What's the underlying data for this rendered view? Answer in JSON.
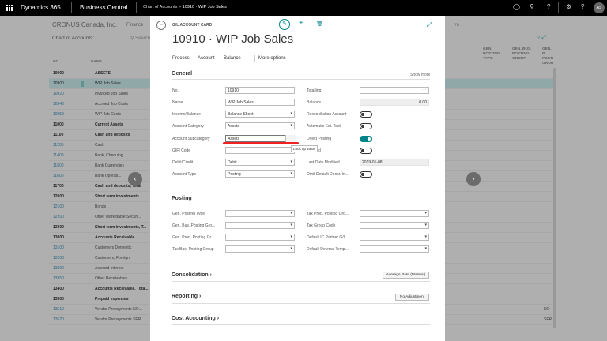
{
  "topbar": {
    "brand": "Dynamics 365",
    "app": "Business Central",
    "crumb_parent": "Chart of Accounts",
    "crumb_current": "10910 · WIP Job Sales",
    "user_initials": "AS"
  },
  "background": {
    "company": "CRONUS Canada, Inc.",
    "nav": "Finance",
    "nav_right": "rm",
    "list_title": "Chart of Accounts:",
    "search": "Search",
    "columns": {
      "no": "NO.",
      "name": "NAME",
      "gen_posting_type": "GEN. POSTING TYPE",
      "gen_bus_posting_group": "GEN. BUS. POSTING GROUP",
      "gen_prod_posting_group": "GEN. P POSTING GROU"
    },
    "rows": [
      {
        "no": "10000",
        "name": "ASSETS",
        "style": "b",
        "right": ""
      },
      {
        "no": "10900",
        "name": "WIP Job Sales",
        "style": "sel",
        "right": ""
      },
      {
        "no": "10920",
        "name": "Invoiced Job Sales",
        "style": "n",
        "right": ""
      },
      {
        "no": "10940",
        "name": "Accrued Job Costs",
        "style": "n",
        "right": ""
      },
      {
        "no": "10950",
        "name": "WIP Job Costs",
        "style": "n",
        "right": ""
      },
      {
        "no": "11000",
        "name": "Current Assets",
        "style": "b",
        "right": ""
      },
      {
        "no": "11100",
        "name": "Cash and deposits",
        "style": "b",
        "right": ""
      },
      {
        "no": "11200",
        "name": "Cash",
        "style": "n",
        "right": ""
      },
      {
        "no": "11400",
        "name": "Bank, Chequing",
        "style": "n",
        "right": ""
      },
      {
        "no": "11500",
        "name": "Bank Currencies",
        "style": "n",
        "right": ""
      },
      {
        "no": "11600",
        "name": "Bank Operati...",
        "style": "n",
        "right": ""
      },
      {
        "no": "11700",
        "name": "Cash and deposits, Total",
        "style": "b",
        "right": ""
      },
      {
        "no": "12000",
        "name": "Short term investments",
        "style": "b",
        "right": ""
      },
      {
        "no": "12100",
        "name": "Bonds",
        "style": "n",
        "right": ""
      },
      {
        "no": "12200",
        "name": "Other Marketable Securi...",
        "style": "n",
        "right": ""
      },
      {
        "no": "12300",
        "name": "Short term investments, T...",
        "style": "b",
        "right": ""
      },
      {
        "no": "13000",
        "name": "Accounts Receivable",
        "style": "b",
        "right": ""
      },
      {
        "no": "13100",
        "name": "Customers Domestic",
        "style": "n",
        "right": ""
      },
      {
        "no": "13200",
        "name": "Customers, Foreign",
        "style": "n",
        "right": ""
      },
      {
        "no": "13300",
        "name": "Accrued Interest",
        "style": "n",
        "right": ""
      },
      {
        "no": "13350",
        "name": "Other Receivables",
        "style": "n",
        "right": ""
      },
      {
        "no": "13400",
        "name": "Accounts Receivable, Tota...",
        "style": "b",
        "right": ""
      },
      {
        "no": "13500",
        "name": "Prepaid expenses",
        "style": "b",
        "right": ""
      },
      {
        "no": "13510",
        "name": "Vendor Prepayments NO...",
        "style": "n",
        "right": "NO"
      },
      {
        "no": "13520",
        "name": "Vendor Prepayments SER...",
        "style": "n",
        "right": "SER"
      }
    ]
  },
  "card": {
    "type": "G/L ACCOUNT CARD",
    "title": "10910 · WIP Job Sales",
    "actions": [
      "Process",
      "Account",
      "Balance",
      "More options"
    ],
    "general": {
      "heading": "General",
      "show_more": "Show more",
      "fields_left": [
        {
          "label": "No.",
          "value": "10910",
          "kind": "text"
        },
        {
          "label": "Name",
          "value": "WIP Job Sales",
          "kind": "text"
        },
        {
          "label": "Income/Balance",
          "value": "Balance Sheet",
          "kind": "select"
        },
        {
          "label": "Account Category",
          "value": "Assets",
          "kind": "select"
        },
        {
          "label": "Account Subcategory",
          "value": "Assets",
          "kind": "lookup"
        },
        {
          "label": "GIFI Code",
          "value": "",
          "kind": "text"
        },
        {
          "label": "Debit/Credit",
          "value": "Debit",
          "kind": "select"
        },
        {
          "label": "Account Type",
          "value": "Posting",
          "kind": "select"
        }
      ],
      "fields_right": [
        {
          "label": "Totalling",
          "value": "",
          "kind": "lookup"
        },
        {
          "label": "Balance",
          "value": "0.00",
          "kind": "readonly"
        },
        {
          "label": "Reconciliation Account",
          "value": "off",
          "kind": "toggle"
        },
        {
          "label": "Automatic Ext. Text",
          "value": "off",
          "kind": "toggle"
        },
        {
          "label": "Direct Posting",
          "value": "on",
          "kind": "toggle"
        },
        {
          "label": "Blocked",
          "value": "off",
          "kind": "toggle"
        },
        {
          "label": "Last Date Modified",
          "value": "2019-01-08",
          "kind": "readonly"
        },
        {
          "label": "Omit Default Descr. in...",
          "value": "off",
          "kind": "toggle"
        }
      ],
      "lookup_symbol": "···",
      "tooltip": "Look up value"
    },
    "posting": {
      "heading": "Posting",
      "fields_left": [
        {
          "label": "Gen. Posting Type",
          "value": ""
        },
        {
          "label": "Gen. Bus. Posting Gro...",
          "value": ""
        },
        {
          "label": "Gen. Prod. Posting Gr...",
          "value": ""
        },
        {
          "label": "Tax Bus. Posting Group",
          "value": ""
        }
      ],
      "fields_right": [
        {
          "label": "Tax Prod. Posting Gro...",
          "value": ""
        },
        {
          "label": "Tax Group Code",
          "value": ""
        },
        {
          "label": "Default IC Partner G/L...",
          "value": ""
        },
        {
          "label": "Default Deferral Temp...",
          "value": ""
        }
      ]
    },
    "consolidation": {
      "heading": "Consolidation",
      "summary": "Average Rate (Manual)"
    },
    "reporting": {
      "heading": "Reporting",
      "summary": "No Adjustment"
    },
    "cost_accounting": {
      "heading": "Cost Accounting"
    }
  }
}
